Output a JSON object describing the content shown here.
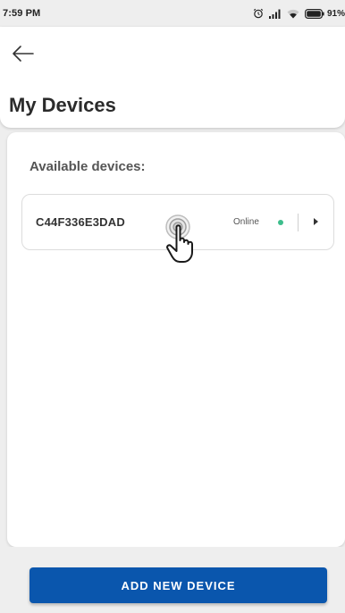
{
  "status_bar": {
    "time": "7:59 PM",
    "battery_percent": "91%",
    "icons": [
      "alarm-icon",
      "signal-icon",
      "wifi-icon",
      "battery-icon"
    ]
  },
  "header": {
    "back_icon": "arrow-left-icon",
    "title": "My Devices"
  },
  "devices_section": {
    "title": "Available devices:",
    "devices": [
      {
        "id": "C44F336E3DAD",
        "status": "Online",
        "status_color": "#3dbd8c",
        "chevron_icon": "chevron-right-icon"
      }
    ]
  },
  "actions": {
    "add_device_label": "ADD NEW DEVICE",
    "button_color": "#0a56ad"
  },
  "overlay": {
    "tap_indicator_icon": "hand-pointer-icon"
  }
}
